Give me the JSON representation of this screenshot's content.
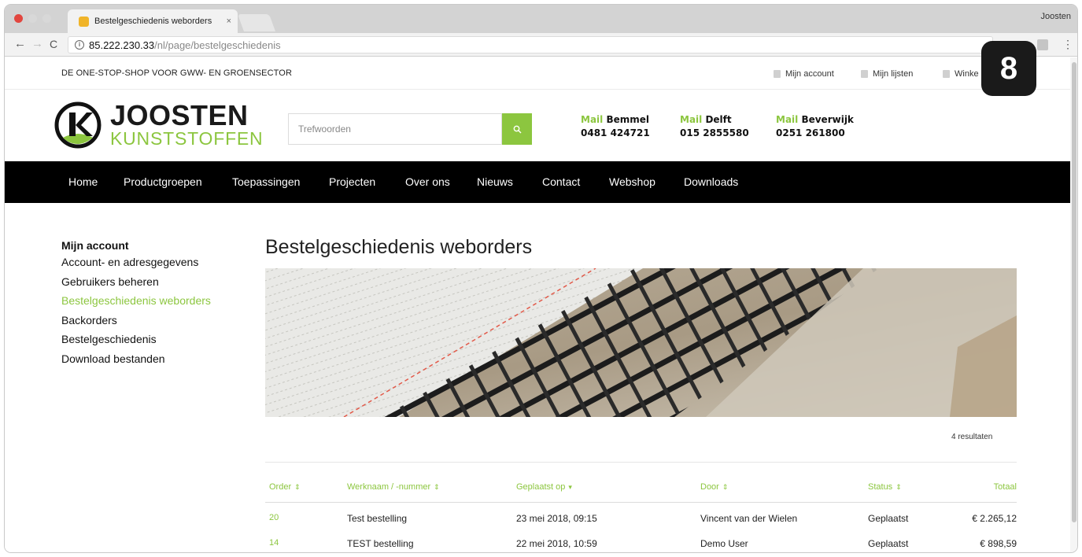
{
  "browser": {
    "tab_title": "Bestelgeschiedenis weborders",
    "tab_close": "×",
    "profile": "Joosten",
    "url_host": "85.222.230.33",
    "url_path": "/nl/page/bestelgeschiedenis",
    "info_icon": "i",
    "menu_dots": "⋮"
  },
  "site": {
    "tagline": "DE ONE-STOP-SHOP VOOR GWW- EN GROENSECTOR",
    "top_links": {
      "account": "Mijn account",
      "lists": "Mijn lijsten",
      "cart": "Winke"
    },
    "logo": {
      "line1": "JOOSTEN",
      "line2": "KUNSTSTOFFEN"
    },
    "search": {
      "placeholder": "Trefwoorden"
    },
    "locations": [
      {
        "mail": "Mail",
        "city": "Bemmel",
        "phone": "0481 424721"
      },
      {
        "mail": "Mail",
        "city": "Delft",
        "phone": "015 2855580"
      },
      {
        "mail": "Mail",
        "city": "Beverwijk",
        "phone": "0251 261800"
      }
    ],
    "nav": [
      "Home",
      "Productgroepen",
      "Toepassingen",
      "Projecten",
      "Over ons",
      "Nieuws",
      "Contact",
      "Webshop",
      "Downloads"
    ]
  },
  "sidebar": {
    "title": "Mijn account",
    "items": [
      {
        "label": "Account- en adresgegevens"
      },
      {
        "label": "Gebruikers beheren"
      },
      {
        "label": "Bestelgeschiedenis weborders"
      },
      {
        "label": "Backorders"
      },
      {
        "label": "Bestelgeschiedenis"
      },
      {
        "label": "Download bestanden"
      }
    ],
    "active_index": 2
  },
  "main": {
    "title": "Bestelgeschiedenis weborders",
    "results": "4 resultaten",
    "table": {
      "headers": [
        {
          "label": "Order",
          "sort": "⇕"
        },
        {
          "label": "Werknaam / -nummer",
          "sort": "⇕"
        },
        {
          "label": "Geplaatst op",
          "sort": "▾"
        },
        {
          "label": "Door",
          "sort": "⇕"
        },
        {
          "label": "Status",
          "sort": "⇕"
        },
        {
          "label": "Totaal",
          "sort": ""
        }
      ],
      "rows": [
        {
          "order": "20",
          "name": "Test bestelling",
          "date": "23 mei 2018, 09:15",
          "by": "Vincent van der Wielen",
          "status": "Geplaatst",
          "total": "€ 2.265,12"
        },
        {
          "order": "14",
          "name": "TEST bestelling",
          "date": "22 mei 2018, 10:59",
          "by": "Demo User",
          "status": "Geplaatst",
          "total": "€ 898,59"
        }
      ]
    }
  },
  "overlay": {
    "step_badge": "8"
  },
  "colors": {
    "accent": "#8cc63f",
    "nav_bg": "#000000"
  }
}
